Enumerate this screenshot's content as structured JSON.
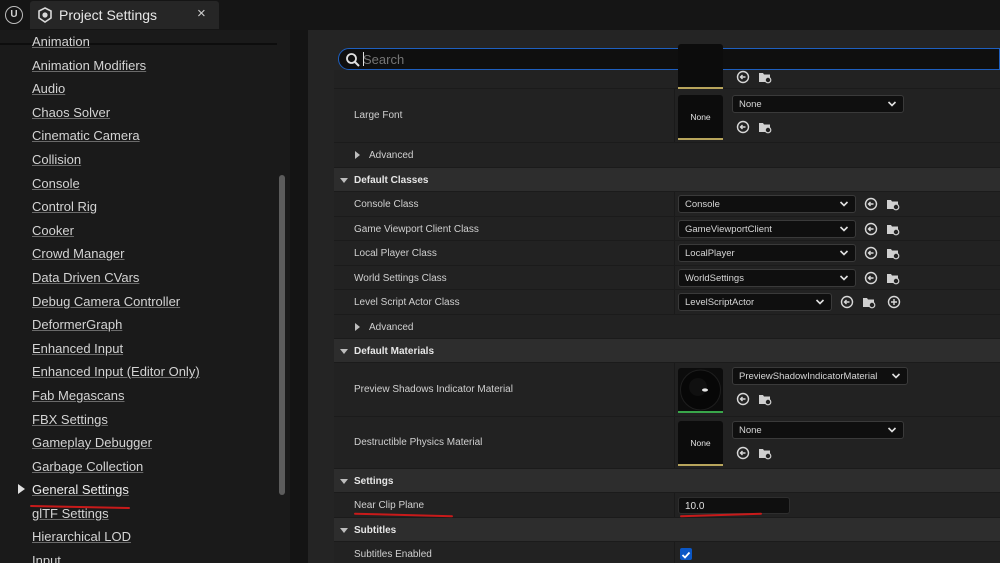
{
  "titlebar": {
    "tab_title": "Project Settings",
    "close_glyph": "×",
    "logo_glyph": "U"
  },
  "sidebar": {
    "items": [
      {
        "label": "Animation"
      },
      {
        "label": "Animation Modifiers"
      },
      {
        "label": "Audio"
      },
      {
        "label": "Chaos Solver"
      },
      {
        "label": "Cinematic Camera"
      },
      {
        "label": "Collision"
      },
      {
        "label": "Console"
      },
      {
        "label": "Control Rig"
      },
      {
        "label": "Cooker"
      },
      {
        "label": "Crowd Manager"
      },
      {
        "label": "Data Driven CVars"
      },
      {
        "label": "Debug Camera Controller"
      },
      {
        "label": "DeformerGraph"
      },
      {
        "label": "Enhanced Input"
      },
      {
        "label": "Enhanced Input (Editor Only)"
      },
      {
        "label": "Fab Megascans"
      },
      {
        "label": "FBX Settings"
      },
      {
        "label": "Gameplay Debugger"
      },
      {
        "label": "Garbage Collection"
      },
      {
        "label": "General Settings"
      },
      {
        "label": "glTF Settings"
      },
      {
        "label": "Hierarchical LOD"
      },
      {
        "label": "Input"
      }
    ],
    "selected": "General Settings"
  },
  "search": {
    "placeholder": "Search",
    "value": ""
  },
  "details": {
    "large_font": {
      "label": "Large Font",
      "thumb": "None",
      "value": "None"
    },
    "advanced_label": "Advanced",
    "default_classes": {
      "header": "Default Classes",
      "rows": [
        {
          "label": "Console Class",
          "value": "Console"
        },
        {
          "label": "Game Viewport Client Class",
          "value": "GameViewportClient"
        },
        {
          "label": "Local Player Class",
          "value": "LocalPlayer"
        },
        {
          "label": "World Settings Class",
          "value": "WorldSettings"
        },
        {
          "label": "Level Script Actor Class",
          "value": "LevelScriptActor"
        }
      ]
    },
    "default_materials": {
      "header": "Default Materials",
      "preview_shadows": {
        "label": "Preview Shadows Indicator Material",
        "value": "PreviewShadowIndicatorMaterial"
      },
      "destructible": {
        "label": "Destructible Physics Material",
        "thumb": "None",
        "value": "None"
      }
    },
    "settings": {
      "header": "Settings",
      "near_clip_plane": {
        "label": "Near Clip Plane",
        "value": "10.0"
      }
    },
    "subtitles": {
      "header": "Subtitles",
      "enabled": {
        "label": "Subtitles Enabled",
        "checked": true
      }
    }
  },
  "colors": {
    "accent_blue": "#1e5fbf",
    "annotation_red": "#c81a1a",
    "checkbox_blue": "#0b57c6"
  },
  "icons": [
    "unreal-logo-icon",
    "settings-icon",
    "close-icon",
    "search-icon",
    "chevron-down-icon",
    "use-selected-icon",
    "browse-icon",
    "add-icon",
    "checkmark-icon"
  ]
}
